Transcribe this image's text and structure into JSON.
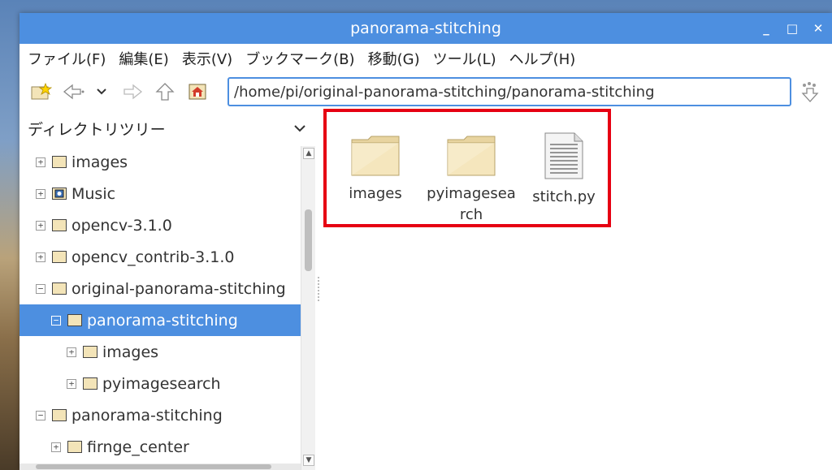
{
  "window": {
    "title": "panorama-stitching",
    "controls": [
      "_",
      "□",
      "✕"
    ]
  },
  "menu": [
    "ファイル(F)",
    "編集(E)",
    "表示(V)",
    "ブックマーク(B)",
    "移動(G)",
    "ツール(L)",
    "ヘルプ(H)"
  ],
  "toolbar": {
    "path": "/home/pi/original-panorama-stitching/panorama-stitching"
  },
  "sidebar": {
    "header": "ディレクトリツリー",
    "items": [
      {
        "label": "images",
        "expander": "+",
        "icon": "folder-icon",
        "indent": 0
      },
      {
        "label": "Music",
        "expander": "+",
        "icon": "music-folder-icon",
        "indent": 0
      },
      {
        "label": "opencv-3.1.0",
        "expander": "+",
        "icon": "folder-icon",
        "indent": 0
      },
      {
        "label": "opencv_contrib-3.1.0",
        "expander": "+",
        "icon": "folder-icon",
        "indent": 0
      },
      {
        "label": "original-panorama-stitching",
        "expander": "−",
        "icon": "folder-icon",
        "indent": 0
      },
      {
        "label": "panorama-stitching",
        "expander": "−",
        "icon": "folder-icon",
        "indent": 1,
        "selected": true
      },
      {
        "label": "images",
        "expander": "+",
        "icon": "folder-icon",
        "indent": 2
      },
      {
        "label": "pyimagesearch",
        "expander": "+",
        "icon": "folder-icon",
        "indent": 2
      },
      {
        "label": "panorama-stitching",
        "expander": "−",
        "icon": "folder-icon",
        "indent": 0
      },
      {
        "label": "firnge_center",
        "expander": "+",
        "icon": "folder-icon",
        "indent": 1
      }
    ]
  },
  "files": [
    {
      "name": "images",
      "type": "folder"
    },
    {
      "name": "pyimagesearch",
      "type": "folder"
    },
    {
      "name": "stitch.py",
      "type": "text-file"
    }
  ],
  "colors": {
    "accent": "#4d8fe0",
    "highlight": "#e60012",
    "folder": "#f3e4b8"
  }
}
